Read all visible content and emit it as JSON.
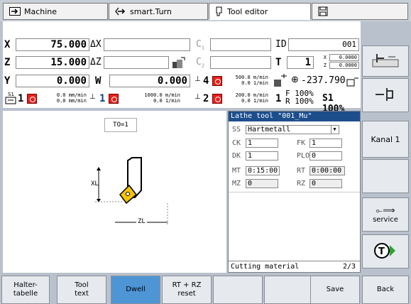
{
  "tabs": [
    {
      "label": "Machine",
      "icon": "arrow-right-icon"
    },
    {
      "label": "smart.Turn",
      "icon": "diamond-arrow-icon"
    },
    {
      "label": "Tool editor",
      "icon": "tool-holder-icon"
    },
    {
      "label": "",
      "icon": "save-icon"
    }
  ],
  "position": {
    "x_label": "X",
    "x_value": "75.000",
    "dx_label": "ΔX",
    "z_label": "Z",
    "z_value": "15.000",
    "dz_label": "ΔZ",
    "y_label": "Y",
    "y_value": "0.000",
    "w_label": "W",
    "w_value": "0.000",
    "c1_label": "C",
    "c1_sub": "1",
    "c2_label": "C",
    "c2_sub": "2",
    "id_label": "ID",
    "id_value": "001",
    "t_label": "T",
    "t_value": "1",
    "tx_label": "X",
    "tx_value": "0.0000",
    "tz_label": "Z",
    "tz_value": "0.0000",
    "spindle4_num": "4",
    "spindle4_rate1": "500.0 m/min",
    "spindle4_rate2": "0.0 1/min",
    "angle_value": "-237.790",
    "s1_label": "S1",
    "s1_num": "1",
    "s1_feed1": "0.0 mm/min",
    "s1_feed2": "0.0 mm/min",
    "spindle1_num": "1",
    "spindle1_rate1": "1000.0 m/min",
    "spindle1_rate2": "0.0 1/min",
    "spindle2_num": "2",
    "spindle2_rate1": "200.0 m/min",
    "spindle2_rate2": "0.0 1/min",
    "feed_num": "1",
    "feed_f": "F 100%",
    "feed_r": "R 100%",
    "feed_s1": "S1 100%"
  },
  "graphic": {
    "to_label": "TO=1",
    "xl_label": "XL",
    "zl_label": "ZL"
  },
  "form": {
    "title": "Lathe tool \"001_Mu\"",
    "ss_label": "SS",
    "ss_value": "Hartmetall",
    "ck_label": "CK",
    "ck_value": "1",
    "fk_label": "FK",
    "fk_value": "1",
    "dk_label": "DK",
    "dk_value": "1",
    "plo_label": "PLO",
    "plo_value": "0",
    "mt_label": "MT",
    "mt_value": "0:15:00",
    "rt_label": "RT",
    "rt_value": "0:00:00",
    "mz_label": "MZ",
    "mz_value": "0",
    "rz_label": "RZ",
    "rz_value": "0",
    "status_text": "Cutting material",
    "page": "2/3"
  },
  "side_softkeys": {
    "kanal": "Kanal 1",
    "service": "service"
  },
  "bottom_softkeys": [
    {
      "label": "Halter-\ntabelle",
      "active": false
    },
    {
      "label": "Tool\ntext",
      "active": false
    },
    {
      "label": "Dwell",
      "active": true
    },
    {
      "label": "RT + RZ\nreset",
      "active": false
    },
    {
      "label": "",
      "active": false
    },
    {
      "label": "",
      "active": false
    },
    {
      "label": "Save",
      "active": false
    },
    {
      "label": "Back",
      "active": false
    }
  ],
  "colors": {
    "active_softkey": "#4e95d6",
    "title_bar": "#1d4e8c",
    "alarm_red": "#e8201c",
    "insert_yellow": "#f5c400"
  }
}
